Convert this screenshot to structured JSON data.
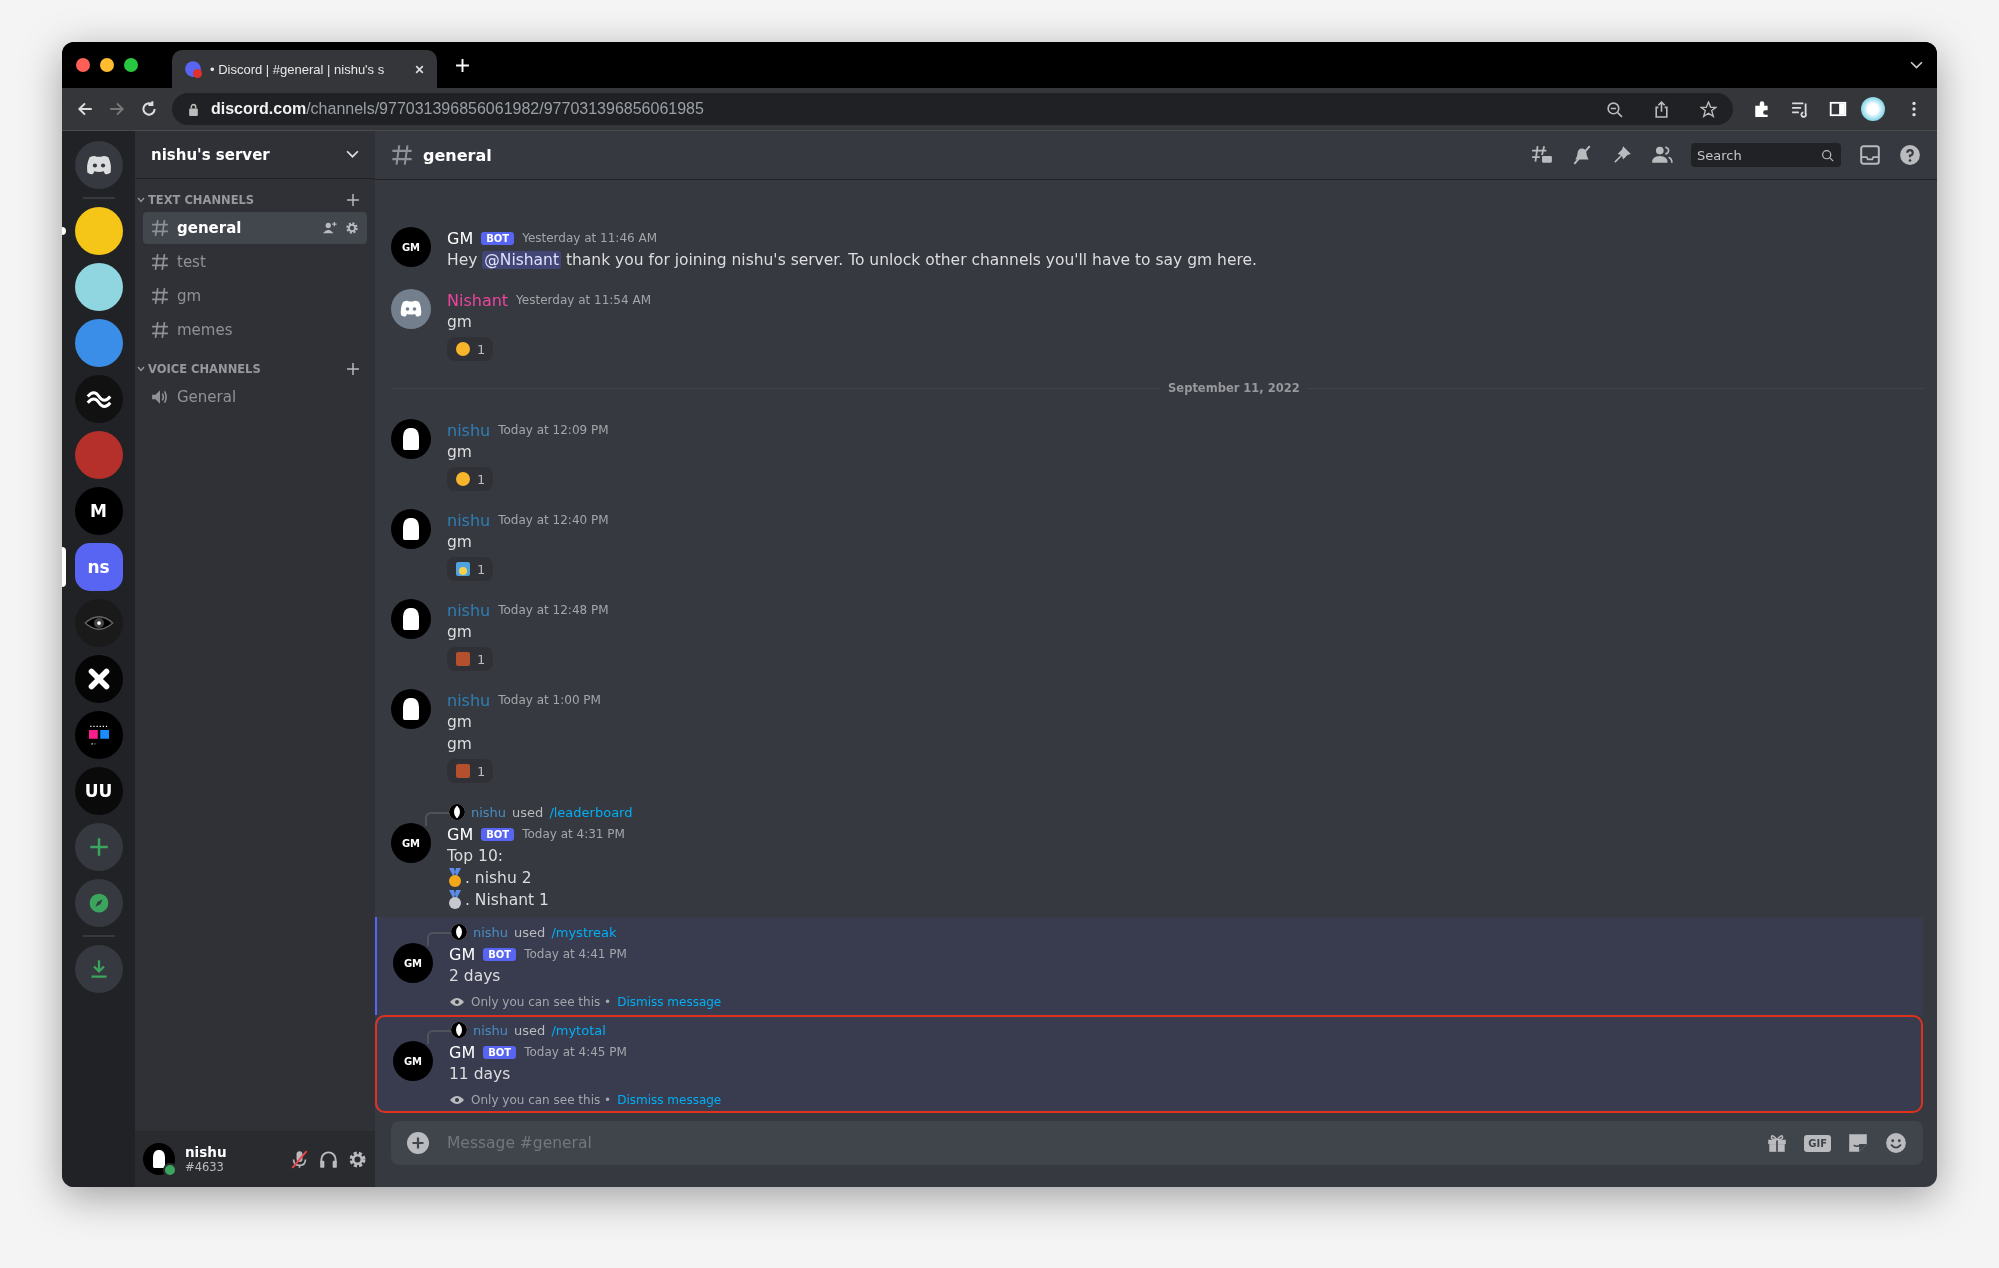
{
  "browser": {
    "tab": {
      "title": "• Discord | #general | nishu's s"
    },
    "url": {
      "host": "discord.com",
      "path": "/channels/977031396856061982/977031396856061985"
    }
  },
  "servers": [
    {
      "kind": "plain",
      "color": "#f5c518",
      "unread": true,
      "selected": false
    },
    {
      "kind": "plain",
      "color": "#8fd6e0",
      "unread": false,
      "selected": false
    },
    {
      "kind": "plain",
      "color": "#3b8ee8",
      "unread": false,
      "selected": false
    },
    {
      "kind": "wave",
      "color": "#111111",
      "unread": false,
      "selected": false
    },
    {
      "kind": "plain",
      "color": "#b5302a",
      "unread": false,
      "selected": false
    },
    {
      "kind": "letter",
      "label": "M",
      "color": "#000000",
      "unread": false,
      "selected": false
    },
    {
      "kind": "letter",
      "label": "ns",
      "color": "#5865f2",
      "unread": false,
      "selected": true
    },
    {
      "kind": "eye",
      "color": "#1a1a1a",
      "unread": false,
      "selected": false
    },
    {
      "kind": "cross",
      "color": "#050505",
      "unread": false,
      "selected": false
    },
    {
      "kind": "pixels",
      "color": "#000000",
      "unread": false,
      "selected": false
    },
    {
      "kind": "letter",
      "label": "UU",
      "color": "#0a0a0a",
      "unread": false,
      "selected": false
    }
  ],
  "sidebar": {
    "server_name": "nishu's server",
    "categories": [
      {
        "name": "TEXT CHANNELS",
        "expanded": true,
        "channels": [
          {
            "name": "general",
            "kind": "text",
            "selected": true
          },
          {
            "name": "test",
            "kind": "text",
            "selected": false
          },
          {
            "name": "gm",
            "kind": "text",
            "selected": false
          },
          {
            "name": "memes",
            "kind": "text",
            "selected": false
          }
        ]
      },
      {
        "name": "VOICE CHANNELS",
        "expanded": true,
        "channels": [
          {
            "name": "General",
            "kind": "voice",
            "selected": false
          }
        ]
      }
    ],
    "user": {
      "name": "nishu",
      "tag": "#4633",
      "muted": true
    }
  },
  "header": {
    "channel": "general",
    "search": {
      "placeholder": "Search"
    }
  },
  "messages": [
    {
      "kind": "message",
      "avatar": {
        "kind": "gm",
        "label": "GM"
      },
      "author": "GM",
      "color": "#ffffff",
      "bot_tag": "BOT",
      "time": "Yesterday at 11:46 AM",
      "parts": [
        {
          "kind": "text",
          "text": "Hey "
        },
        {
          "kind": "mention",
          "text": "@Nishant"
        },
        {
          "kind": "text",
          "text": " thank you for joining nishu's server. To unlock other channels you'll have to say gm here."
        }
      ],
      "ephemeral": false,
      "annotated": false
    },
    {
      "kind": "message",
      "avatar": {
        "kind": "discord"
      },
      "author": "Nishant",
      "color": "#eb459e",
      "time": "Yesterday at 11:54 AM",
      "lines": [
        {
          "text": "gm"
        }
      ],
      "reactions": [
        {
          "kind": "sun",
          "count": "1"
        }
      ],
      "ephemeral": false,
      "annotated": false
    },
    {
      "kind": "divider",
      "text": "September 11, 2022"
    },
    {
      "kind": "message",
      "avatar": {
        "kind": "pixel"
      },
      "author": "nishu",
      "color": "#2e7fb5",
      "time": "Today at 12:09 PM",
      "lines": [
        {
          "text": "gm"
        }
      ],
      "reactions": [
        {
          "kind": "sun",
          "count": "1"
        }
      ],
      "ephemeral": false,
      "annotated": false
    },
    {
      "kind": "message",
      "avatar": {
        "kind": "pixel"
      },
      "author": "nishu",
      "color": "#2e7fb5",
      "time": "Today at 12:40 PM",
      "lines": [
        {
          "text": "gm"
        }
      ],
      "reactions": [
        {
          "kind": "sunrise",
          "count": "1"
        }
      ],
      "ephemeral": false,
      "annotated": false
    },
    {
      "kind": "message",
      "avatar": {
        "kind": "pixel"
      },
      "author": "nishu",
      "color": "#2e7fb5",
      "time": "Today at 12:48 PM",
      "lines": [
        {
          "text": "gm"
        }
      ],
      "reactions": [
        {
          "kind": "picture",
          "count": "1"
        }
      ],
      "ephemeral": false,
      "annotated": false
    },
    {
      "kind": "message",
      "avatar": {
        "kind": "pixel"
      },
      "author": "nishu",
      "color": "#2e7fb5",
      "time": "Today at 1:00 PM",
      "lines": [
        {
          "text": "gm"
        },
        {
          "text": "gm"
        }
      ],
      "reactions": [
        {
          "kind": "picture",
          "count": "1"
        }
      ],
      "ephemeral": false,
      "annotated": false
    },
    {
      "kind": "message",
      "avatar": {
        "kind": "gm",
        "label": "GM"
      },
      "author": "GM",
      "color": "#ffffff",
      "bot_tag": "BOT",
      "time": "Today at 4:31 PM",
      "interaction": {
        "user": "nishu",
        "verb": "used",
        "command": "/leaderboard"
      },
      "lines": [
        {
          "text": "Top 10:"
        },
        {
          "kind": "gold",
          "text": ". nishu 2"
        },
        {
          "kind": "silver",
          "text": ". Nishant 1"
        }
      ],
      "ephemeral": false,
      "annotated": false
    },
    {
      "kind": "message",
      "avatar": {
        "kind": "gm",
        "label": "GM"
      },
      "author": "GM",
      "color": "#ffffff",
      "bot_tag": "BOT",
      "time": "Today at 4:41 PM",
      "interaction": {
        "user": "nishu",
        "verb": "used",
        "command": "/mystreak"
      },
      "lines": [
        {
          "text": "2 days"
        }
      ],
      "ephemeral": true,
      "notice": "Only you can see this •",
      "dismiss": "Dismiss message",
      "annotated": false
    },
    {
      "kind": "message",
      "avatar": {
        "kind": "gm",
        "label": "GM"
      },
      "author": "GM",
      "color": "#ffffff",
      "bot_tag": "BOT",
      "time": "Today at 4:45 PM",
      "interaction": {
        "user": "nishu",
        "verb": "used",
        "command": "/mytotal"
      },
      "lines": [
        {
          "text": "11 days"
        }
      ],
      "ephemeral": true,
      "notice": "Only you can see this •",
      "dismiss": "Dismiss message",
      "annotated": true
    }
  ],
  "composer": {
    "placeholder": "Message #general",
    "gif_label": "GIF"
  }
}
